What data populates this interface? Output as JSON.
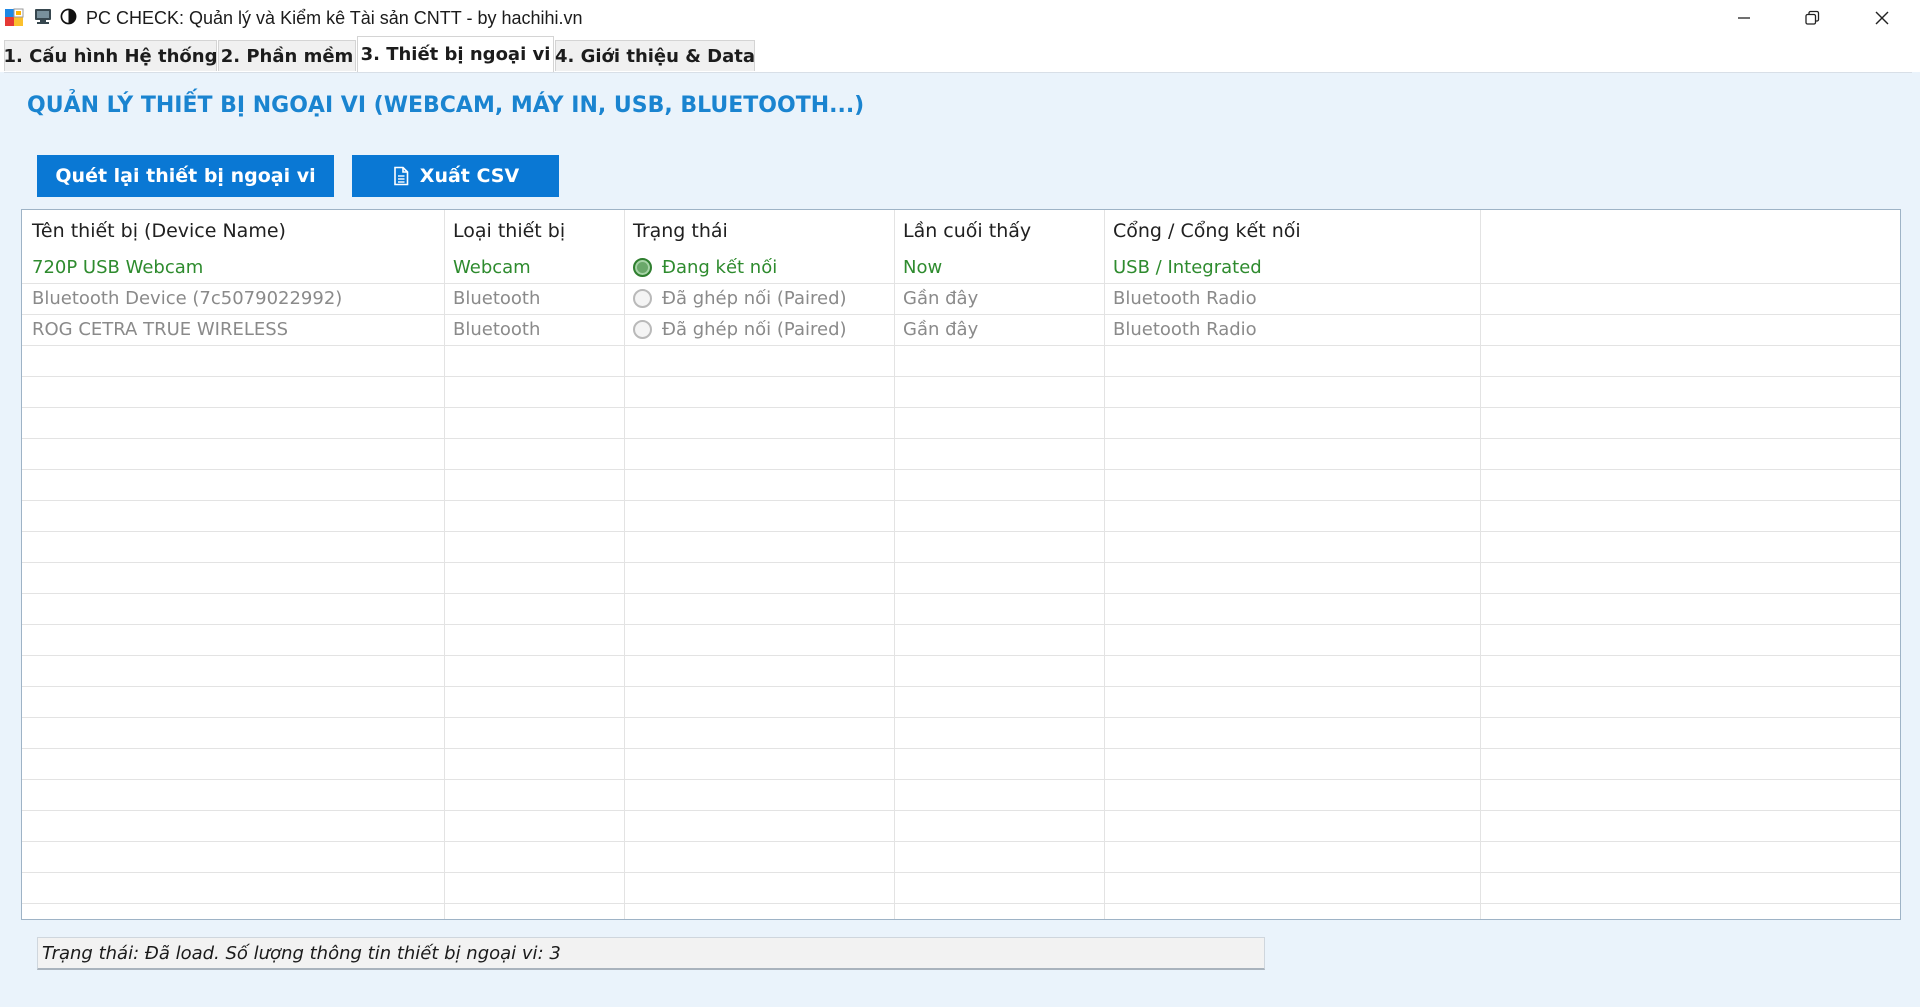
{
  "window": {
    "title": "PC CHECK: Quản lý và Kiểm kê Tài sản CNTT - by hachihi.vn",
    "icons": [
      "app-icon",
      "monitor-icon",
      "halfmoon-icon"
    ],
    "controls": [
      "minimize-icon",
      "restore-icon",
      "close-icon"
    ]
  },
  "tabs": [
    {
      "label": "1. Cấu hình Hệ thống",
      "active": false
    },
    {
      "label": "2. Phần mềm",
      "active": false
    },
    {
      "label": "3. Thiết bị ngoại vi",
      "active": true
    },
    {
      "label": "4. Giới thiệu & Data",
      "active": false
    }
  ],
  "page": {
    "heading": "QUẢN LÝ THIẾT BỊ NGOẠI VI (WEBCAM, MÁY IN, USB, BLUETOOTH...)",
    "accent_color": "#1a84d0",
    "button_color": "#0a78d4"
  },
  "toolbar": {
    "scan_label": "Quét lại thiết bị ngoại vi",
    "export_label": "Xuất CSV",
    "export_icon": "document-icon"
  },
  "table": {
    "columns": [
      "Tên thiết bị (Device Name)",
      "Loại thiết bị",
      "Trạng thái",
      "Lần cuối thấy",
      "Cổng / Cổng kết nối"
    ],
    "rows": [
      {
        "name": "720P USB Webcam",
        "type": "Webcam",
        "status": "Đang kết nối",
        "last_seen": "Now",
        "port": "USB / Integrated",
        "status_color": "#2e8b2e"
      },
      {
        "name": "Bluetooth Device (7c5079022992)",
        "type": "Bluetooth",
        "status": "Đã ghép nối (Paired)",
        "last_seen": "Gần đây",
        "port": "Bluetooth Radio",
        "status_color": "#8a8a8a"
      },
      {
        "name": "ROG CETRA TRUE WIRELESS",
        "type": "Bluetooth",
        "status": "Đã ghép nối (Paired)",
        "last_seen": "Gần đây",
        "port": "Bluetooth Radio",
        "status_color": "#8a8a8a"
      }
    ]
  },
  "status_bar": {
    "text": "Trạng thái: Đã load. Số lượng thông tin thiết bị ngoại vi: 3"
  }
}
